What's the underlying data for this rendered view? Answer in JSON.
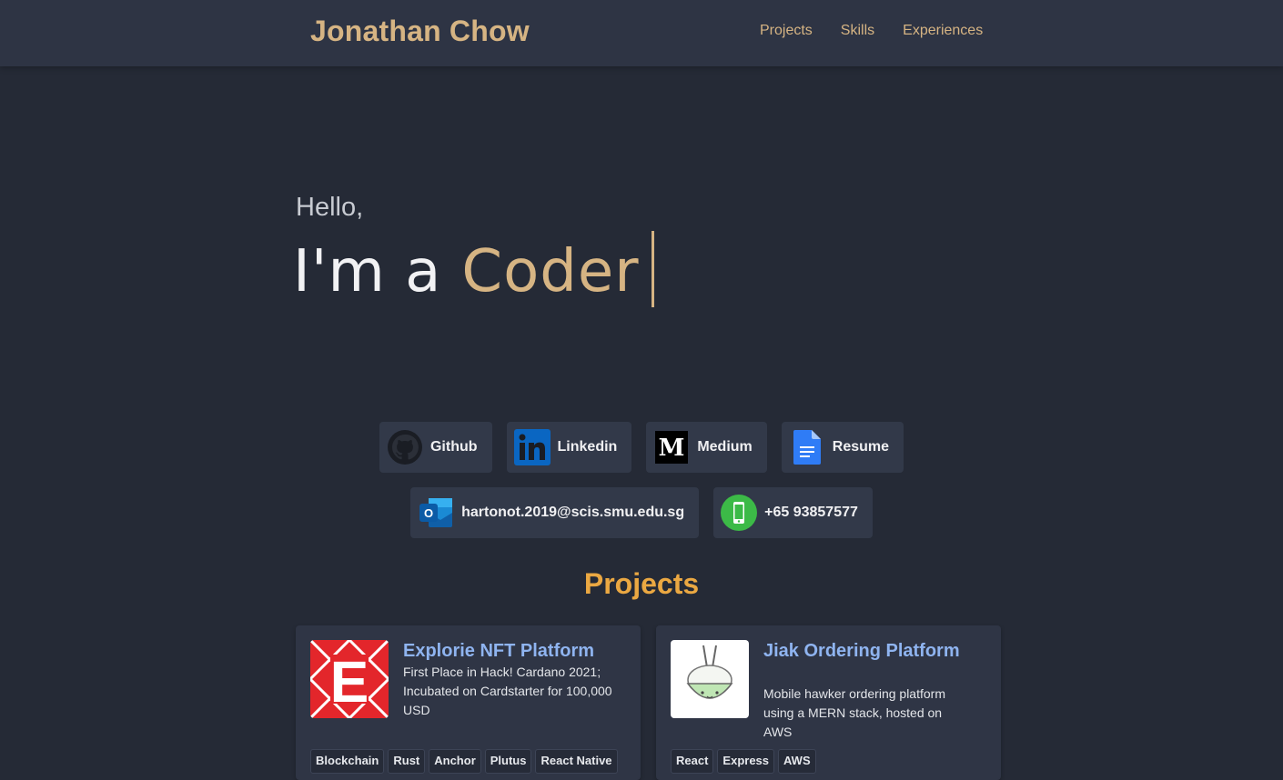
{
  "header": {
    "brand": "Jonathan Chow",
    "nav": [
      "Projects",
      "Skills",
      "Experiences"
    ]
  },
  "hero": {
    "greeting": "Hello,",
    "prefix": "I'm a",
    "role": "Coder"
  },
  "links": {
    "github": {
      "label": "Github",
      "icon": "github-icon"
    },
    "linkedin": {
      "label": "Linkedin",
      "icon": "linkedin-icon"
    },
    "medium": {
      "label": "Medium",
      "icon": "medium-icon"
    },
    "resume": {
      "label": "Resume",
      "icon": "google-docs-icon"
    },
    "email": {
      "label": "hartonot.2019@scis.smu.edu.sg",
      "icon": "outlook-icon"
    },
    "phone": {
      "label": "+65 93857577",
      "icon": "phone-icon"
    },
    "medium_glyph": "M",
    "outlook_glyph": "O"
  },
  "projects": {
    "title": "Projects",
    "items": [
      {
        "title": "Explorie NFT Platform",
        "description": "First Place in Hack! Cardano 2021; Incubated on Cardstarter for 100,000 USD",
        "logo_letter": "E",
        "tags": [
          "Blockchain",
          "Rust",
          "Anchor",
          "Plutus",
          "React Native"
        ]
      },
      {
        "title": "Jiak Ordering Platform",
        "description": "Mobile hawker ordering platform using a MERN stack, hosted on AWS",
        "tags": [
          "React",
          "Express",
          "AWS"
        ]
      }
    ]
  },
  "colors": {
    "background": "#252a36",
    "navbar": "#2e3444",
    "accent_gold": "#d6b483",
    "section_orange": "#eba842",
    "card_title_blue": "#8fb4f0"
  }
}
